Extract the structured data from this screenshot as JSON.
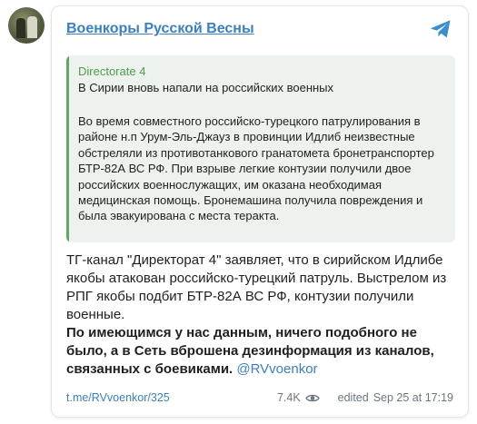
{
  "channel": {
    "name": "Военкоры Русской Весны"
  },
  "repost": {
    "source": "Directorate 4",
    "title": "В Сирии вновь напали на российских военных",
    "body": "Во время совместного российско-турецкого патрулирования в районе н.п Урум-Эль-Джауз в провинции Идлиб неизвестные обстреляли из противотанкового гранатомета бронетранспортер БТР-82А ВС РФ. При взрыве легкие контузии получили двое российских военнослужащих, им оказана необходимая медицинская помощь. Бронемашина получила повреждения и была эвакуирована с места теракта."
  },
  "post": {
    "text": "ТГ-канал \"Директорат 4\" заявляет, что в сирийском Идлибе якобы атакован российско-турецкий патруль. Выстрелом из РПГ якобы подбит БТР-82А ВС РФ, контузии получили военные.",
    "bold_text": "По имеющимся у нас данным, ничего подобного не было, а в Сеть вброшена дезинформация из каналов, связанных с боевиками.",
    "mention": "@RVvoenkor"
  },
  "footer": {
    "link": "t.me/RVvoenkor/325",
    "views": "7.4K",
    "edited": "edited",
    "date": "Sep 25 at 17:19"
  },
  "icons": {
    "logo": "telegram-icon",
    "views": "eye-icon"
  },
  "colors": {
    "link": "#3a7fc4",
    "repost_accent": "#5fa85e",
    "repost_bg": "#eef2ee",
    "meta": "#6b7780"
  }
}
